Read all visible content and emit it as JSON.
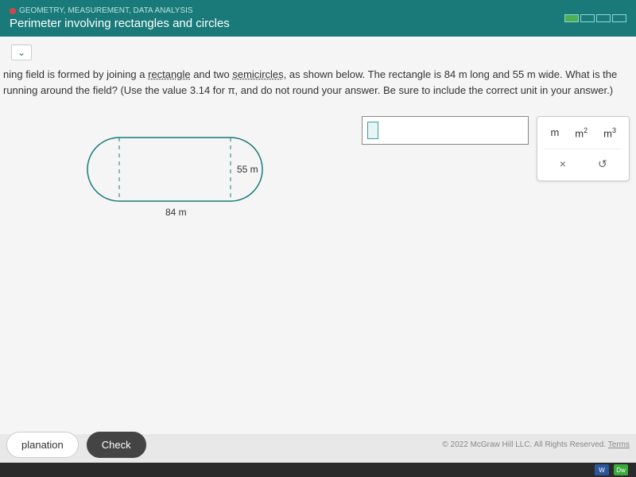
{
  "header": {
    "category": "GEOMETRY, MEASUREMENT, DATA ANALYSIS",
    "title": "Perimeter involving rectangles and circles"
  },
  "problem": {
    "text_part1": "ning field is formed by joining a ",
    "term_rectangle": "rectangle",
    "text_part2": " and two ",
    "term_semicircles": "semicircles",
    "text_part3": ", as shown below. The rectangle is 84 m long and 55 m wide. What is the",
    "text_line2": "running around the field? (Use the value 3.14 for π, and do not round your answer. Be sure to include the correct unit in your answer.)"
  },
  "figure": {
    "width_label": "84 m",
    "height_label": "55 m"
  },
  "units": {
    "m": "m",
    "m2": "m",
    "m2_sup": "2",
    "m3": "m",
    "m3_sup": "3",
    "clear": "×",
    "undo": "↺"
  },
  "buttons": {
    "explanation": "planation",
    "check": "Check"
  },
  "footer": {
    "copyright": "© 2022 McGraw Hill LLC. All Rights Reserved.",
    "terms": "Terms"
  },
  "taskbar": {
    "word": "W",
    "dw": "Dw"
  }
}
